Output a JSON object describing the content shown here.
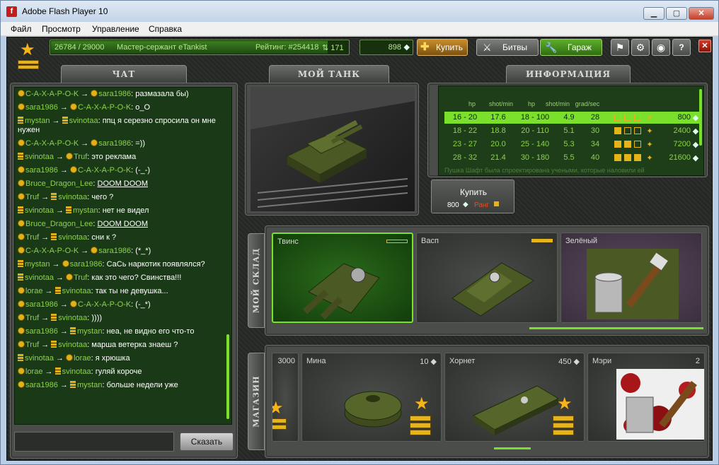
{
  "window": {
    "title": "Adobe Flash Player 10",
    "menu": [
      "Файл",
      "Просмотр",
      "Управление",
      "Справка"
    ]
  },
  "topbar": {
    "xp": "26784 / 29000",
    "rank_name": "Мастер-сержант eTankist",
    "rating": "Рейтинг: #254418",
    "rating_change": "171",
    "crystals": "898",
    "buy_label": "Купить",
    "battles_label": "Битвы",
    "garage_label": "Гараж"
  },
  "tabs": {
    "chat": "ЧАТ",
    "my_tank": "МОЙ ТАНК",
    "info": "ИНФОРМАЦИЯ",
    "warehouse": "МОЙ СКЛАД",
    "shop": "МАГАЗИН"
  },
  "chat": {
    "messages": [
      {
        "from": "C-A-X-A-P-O-K",
        "to": "sara1986",
        "text": "размазала бы)"
      },
      {
        "from": "sara1986",
        "to": "C-A-X-A-P-O-K",
        "text": "o_O"
      },
      {
        "from": "mystan",
        "to": "svinotaa",
        "text": "ппц я серезно спросила он мне нужен"
      },
      {
        "from": "C-A-X-A-P-O-K",
        "to": "sara1986",
        "text": "=))"
      },
      {
        "from": "svinotaa",
        "to": "Truf",
        "text": "это реклама"
      },
      {
        "from": "sara1986",
        "to": "C-A-X-A-P-O-K",
        "text": "(-_-)"
      },
      {
        "from": "Bruce_Dragon_Lee",
        "to": "",
        "text": "DOOM DOOM"
      },
      {
        "from": "Truf",
        "to": "svinotaa",
        "text": "чего ?"
      },
      {
        "from": "svinotaa",
        "to": "mystan",
        "text": "нет не видел"
      },
      {
        "from": "Bruce_Dragon_Lee",
        "to": "",
        "text": "DOOM DOOM"
      },
      {
        "from": "Truf",
        "to": "svinotaa",
        "text": "сни к ?"
      },
      {
        "from": "C-A-X-A-P-O-K",
        "to": "sara1986",
        "text": "(*_*)"
      },
      {
        "from": "mystan",
        "to": "sara1986",
        "text": "СаСь наркотик появлялся?"
      },
      {
        "from": "svinotaa",
        "to": "Truf",
        "text": "как это чего? Свинства!!!"
      },
      {
        "from": "lorae",
        "to": "svinotaa",
        "text": "так ты не девушка..."
      },
      {
        "from": "sara1986",
        "to": "C-A-X-A-P-O-K",
        "text": "(-_*)"
      },
      {
        "from": "Truf",
        "to": "svinotaa",
        "text": "))))"
      },
      {
        "from": "sara1986",
        "to": "mystan",
        "text": "неа, не видно его что-то"
      },
      {
        "from": "Truf",
        "to": "svinotaa",
        "text": "марша ветерка знаеш ?"
      },
      {
        "from": "svinotaa",
        "to": "lorae",
        "text": "я хрюшка"
      },
      {
        "from": "lorae",
        "to": "svinotaa",
        "text": "гуляй короче"
      },
      {
        "from": "sara1986",
        "to": "mystan",
        "text": "больше недели уже"
      }
    ],
    "input_value": "",
    "send_label": "Сказать"
  },
  "info": {
    "headers": [
      "hp",
      "shot/min",
      "hp",
      "shot/min",
      "grad/sec"
    ],
    "rows": [
      {
        "range": "16 - 20",
        "shot": "17.6",
        "hp": "18 - 100",
        "spd": "4.9",
        "grad": "28",
        "price": "800",
        "selected": true
      },
      {
        "range": "18 - 22",
        "shot": "18.8",
        "hp": "20 - 110",
        "spd": "5.1",
        "grad": "30",
        "price": "2400",
        "selected": false
      },
      {
        "range": "23 - 27",
        "shot": "20.0",
        "hp": "25 - 140",
        "spd": "5.3",
        "grad": "34",
        "price": "7200",
        "selected": false
      },
      {
        "range": "28 - 32",
        "shot": "21.4",
        "hp": "30 - 180",
        "spd": "5.5",
        "grad": "40",
        "price": "21600",
        "selected": false
      }
    ],
    "description": "Пушка Шафт была спроектирована учеными, которые наловили ей",
    "buy_label": "Купить",
    "buy_price": "800",
    "rank_label": "Ранг"
  },
  "warehouse": {
    "items": [
      {
        "name": "Твинс"
      },
      {
        "name": "Васп"
      },
      {
        "name": "Зелёный"
      }
    ]
  },
  "shop": {
    "partial_price": "3000",
    "items": [
      {
        "name": "Мина",
        "price": "10"
      },
      {
        "name": "Хорнет",
        "price": "450"
      },
      {
        "name": "Мэри",
        "price": "2"
      }
    ]
  },
  "colors": {
    "accent_green": "#7ae02c",
    "chat_bg": "#1a3a17",
    "gold": "#e5b31a"
  }
}
